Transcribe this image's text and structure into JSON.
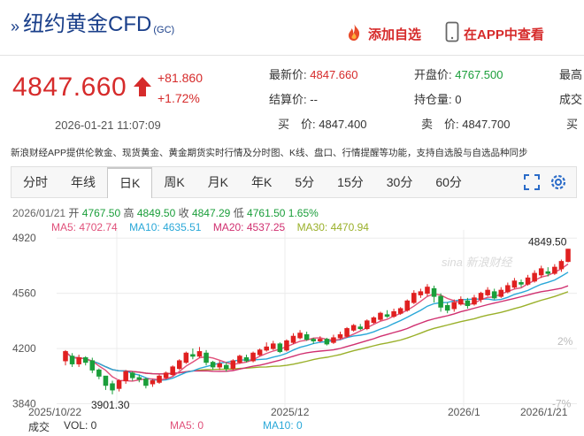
{
  "header": {
    "title_prefix": "»",
    "title": "纽约黄金CFD",
    "code": "(GC)",
    "add_favorite": "添加自选",
    "view_in_app": "在APP中查看"
  },
  "quote": {
    "price": "4847.660",
    "change": "+81.860",
    "change_pct": "+1.72%",
    "time": "2026-01-21 11:07:09",
    "fields": [
      {
        "label": "最新价:",
        "value": "4847.660",
        "color": "red"
      },
      {
        "label": "开盘价:",
        "value": "4767.500",
        "color": "green"
      },
      {
        "label": "最高",
        "value": "",
        "color": "black"
      },
      {
        "label": "结算价:",
        "value": "--",
        "color": "black"
      },
      {
        "label": "持仓量:",
        "value": "0",
        "color": "black"
      },
      {
        "label": "成交",
        "value": "",
        "color": "black"
      },
      {
        "label": "买　价:",
        "value": "4847.400",
        "color": "black"
      },
      {
        "label": "卖　价:",
        "value": "4847.700",
        "color": "black"
      },
      {
        "label": "买",
        "value": "",
        "color": "black"
      }
    ]
  },
  "notice": "新浪财经APP提供伦敦金、现货黄金、黄金期货实时行情及分时图、K线、盘口、行情提醒等功能，支持自选股与自选品种同步",
  "tabs": [
    "分时",
    "年线",
    "日K",
    "周K",
    "月K",
    "年K",
    "5分",
    "15分",
    "30分",
    "60分"
  ],
  "active_tab": "日K",
  "chart": {
    "info": {
      "date": "2026/01/21",
      "open_label": "开",
      "open": "4767.50",
      "high_label": "高",
      "high": "4849.50",
      "close_label": "收",
      "close": "4847.29",
      "low_label": "低",
      "low": "4761.50",
      "pct": "1.65%"
    },
    "ma": {
      "ma5": "MA5: 4702.74",
      "ma10": "MA10: 4635.51",
      "ma20": "MA20: 4537.25",
      "ma30": "MA30: 4470.94"
    },
    "watermark": "sina 新浪财经",
    "bottom": {
      "vol_label": "成交",
      "vol": "VOL: 0",
      "ma5": "MA5: 0",
      "ma10": "MA10: 0"
    },
    "colors": {
      "up": "#e02020",
      "down": "#1a9e3a",
      "ma5": "#e0507a",
      "ma10": "#2aa8d8",
      "ma20": "#d03070",
      "ma30": "#9ab02a"
    }
  },
  "chart_data": {
    "type": "candlestick",
    "y_ticks": [
      "4920",
      "4560",
      "4200",
      "3840"
    ],
    "y_range": [
      3820,
      4950
    ],
    "x_labels": [
      "2025/10/22",
      "2025/12",
      "2026/1",
      "2026/1/21"
    ],
    "right_ticks": [
      "2%",
      "-7%"
    ],
    "annotations": {
      "max": "4849.50",
      "min": "3901.30"
    },
    "candles": [
      [
        4120,
        4180,
        4090,
        4190
      ],
      [
        4150,
        4100,
        4080,
        4170
      ],
      [
        4100,
        4140,
        4080,
        4160
      ],
      [
        4140,
        4110,
        4090,
        4150
      ],
      [
        4120,
        4060,
        4040,
        4140
      ],
      [
        4060,
        4020,
        4000,
        4070
      ],
      [
        4020,
        3960,
        3930,
        3990
      ],
      [
        3970,
        3930,
        3901.3,
        3990
      ],
      [
        3940,
        3990,
        3920,
        4000
      ],
      [
        3990,
        4050,
        3970,
        4060
      ],
      [
        4040,
        4010,
        3990,
        4050
      ],
      [
        4010,
        4000,
        3980,
        4030
      ],
      [
        4000,
        3960,
        3940,
        4010
      ],
      [
        3970,
        3990,
        3950,
        4000
      ],
      [
        3980,
        4020,
        3970,
        4030
      ],
      [
        4010,
        4040,
        4000,
        4050
      ],
      [
        4030,
        4080,
        4020,
        4090
      ],
      [
        4070,
        4120,
        4060,
        4130
      ],
      [
        4110,
        4170,
        4100,
        4180
      ],
      [
        4160,
        4150,
        4130,
        4200
      ],
      [
        4150,
        4180,
        4140,
        4210
      ],
      [
        4170,
        4110,
        4090,
        4190
      ],
      [
        4110,
        4080,
        4060,
        4120
      ],
      [
        4080,
        4100,
        4060,
        4120
      ],
      [
        4090,
        4070,
        4050,
        4110
      ],
      [
        4070,
        4120,
        4060,
        4130
      ],
      [
        4110,
        4150,
        4100,
        4160
      ],
      [
        4140,
        4120,
        4110,
        4160
      ],
      [
        4120,
        4170,
        4110,
        4180
      ],
      [
        4160,
        4190,
        4150,
        4200
      ],
      [
        4190,
        4210,
        4180,
        4240
      ],
      [
        4200,
        4230,
        4190,
        4250
      ],
      [
        4230,
        4180,
        4170,
        4240
      ],
      [
        4190,
        4250,
        4180,
        4260
      ],
      [
        4240,
        4280,
        4230,
        4300
      ],
      [
        4270,
        4300,
        4260,
        4320
      ],
      [
        4290,
        4260,
        4250,
        4310
      ],
      [
        4260,
        4250,
        4230,
        4270
      ],
      [
        4250,
        4260,
        4240,
        4280
      ],
      [
        4260,
        4230,
        4220,
        4270
      ],
      [
        4240,
        4270,
        4230,
        4290
      ],
      [
        4270,
        4290,
        4260,
        4310
      ],
      [
        4280,
        4330,
        4270,
        4340
      ],
      [
        4320,
        4350,
        4310,
        4360
      ],
      [
        4340,
        4330,
        4320,
        4360
      ],
      [
        4330,
        4380,
        4320,
        4390
      ],
      [
        4370,
        4400,
        4360,
        4410
      ],
      [
        4390,
        4430,
        4380,
        4440
      ],
      [
        4420,
        4410,
        4400,
        4450
      ],
      [
        4410,
        4440,
        4400,
        4460
      ],
      [
        4430,
        4460,
        4420,
        4470
      ],
      [
        4450,
        4510,
        4440,
        4520
      ],
      [
        4500,
        4560,
        4490,
        4580
      ],
      [
        4550,
        4570,
        4530,
        4590
      ],
      [
        4560,
        4600,
        4540,
        4620
      ],
      [
        4590,
        4540,
        4500,
        4610
      ],
      [
        4540,
        4470,
        4440,
        4560
      ],
      [
        4480,
        4450,
        4430,
        4500
      ],
      [
        4460,
        4500,
        4440,
        4520
      ],
      [
        4490,
        4520,
        4480,
        4540
      ],
      [
        4510,
        4480,
        4460,
        4530
      ],
      [
        4490,
        4530,
        4480,
        4550
      ],
      [
        4520,
        4560,
        4500,
        4570
      ],
      [
        4550,
        4580,
        4540,
        4600
      ],
      [
        4570,
        4530,
        4520,
        4590
      ],
      [
        4540,
        4580,
        4530,
        4600
      ],
      [
        4570,
        4610,
        4560,
        4630
      ],
      [
        4600,
        4640,
        4590,
        4660
      ],
      [
        4630,
        4620,
        4600,
        4650
      ],
      [
        4620,
        4660,
        4610,
        4680
      ],
      [
        4640,
        4690,
        4630,
        4710
      ],
      [
        4680,
        4720,
        4660,
        4740
      ],
      [
        4700,
        4690,
        4670,
        4730
      ],
      [
        4690,
        4730,
        4680,
        4750
      ],
      [
        4720,
        4767.5,
        4700,
        4780
      ],
      [
        4767.5,
        4847.29,
        4761.5,
        4849.5
      ]
    ]
  }
}
